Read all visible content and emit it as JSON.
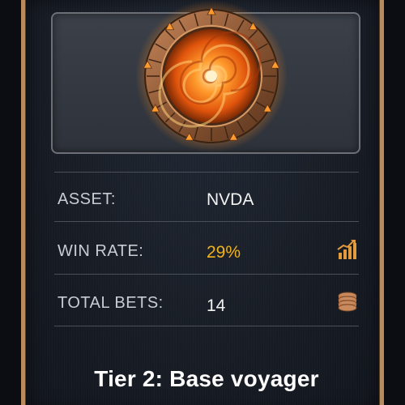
{
  "card": {
    "rows": [
      {
        "label": "ASSET:",
        "value": "NVDA",
        "icon": ""
      },
      {
        "label": "WIN RATE:",
        "value": "29%",
        "icon": "trend-up-bar-chart-icon"
      },
      {
        "label": "TOTAL BETS:",
        "value": "14",
        "icon": "coin-stack-icon"
      }
    ],
    "tier_title": "Tier 2: Base voyager"
  },
  "colors": {
    "frame_border": "#b98a5c",
    "accent": "#f0b21d",
    "icon": "#e39a3c",
    "portal_glow": "#ff8a1c"
  },
  "icons": {
    "portal": "stargate-portal-icon"
  }
}
